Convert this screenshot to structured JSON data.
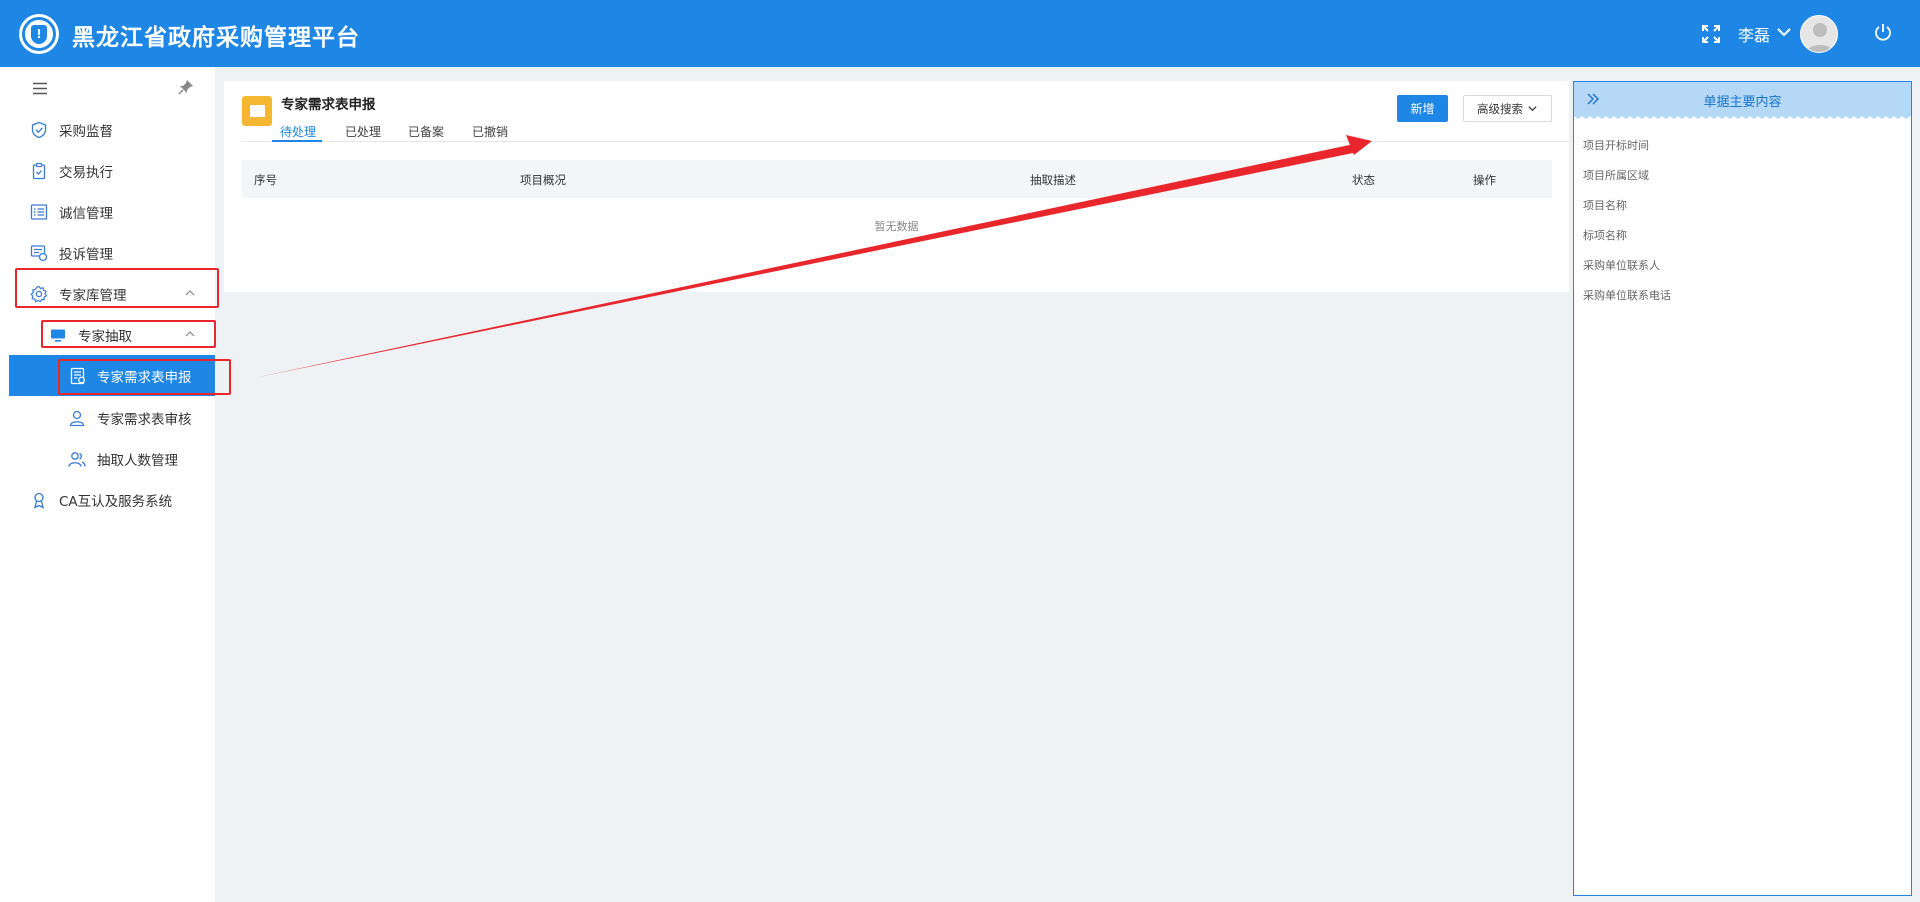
{
  "header": {
    "title": "黑龙江省政府采购管理平台",
    "user_name": "李磊",
    "bg_color": "#1e87e5"
  },
  "sidebar": {
    "items": [
      {
        "label": "采购监督",
        "icon": "shield-check-icon"
      },
      {
        "label": "交易执行",
        "icon": "clipboard-icon"
      },
      {
        "label": "诚信管理",
        "icon": "list-check-icon"
      },
      {
        "label": "投诉管理",
        "icon": "complaint-icon"
      },
      {
        "label": "专家库管理",
        "icon": "gear-icon",
        "expanded": true
      },
      {
        "label": "专家抽取",
        "icon": "monitor-icon",
        "expanded": true
      },
      {
        "label": "专家需求表申报",
        "icon": "form-icon",
        "active": true
      },
      {
        "label": "专家需求表审核",
        "icon": "user-icon"
      },
      {
        "label": "抽取人数管理",
        "icon": "users-icon"
      },
      {
        "label": "CA互认及服务系统",
        "icon": "certificate-icon"
      }
    ]
  },
  "main": {
    "title": "专家需求表申报",
    "tabs": [
      {
        "label": "待处理",
        "active": true
      },
      {
        "label": "已处理"
      },
      {
        "label": "已备案"
      },
      {
        "label": "已撤销"
      }
    ],
    "add_label": "新增",
    "advanced_search_label": "高级搜索",
    "table": {
      "columns": [
        "序号",
        "项目概况",
        "抽取描述",
        "状态",
        "操作"
      ],
      "empty_text": "暂无数据"
    }
  },
  "right_panel": {
    "title": "单据主要内容",
    "fields": [
      "项目开标时间",
      "项目所属区域",
      "项目名称",
      "标项名称",
      "采购单位联系人",
      "采购单位联系电话"
    ]
  },
  "annotations": {
    "highlight_color": "#e8262b"
  }
}
